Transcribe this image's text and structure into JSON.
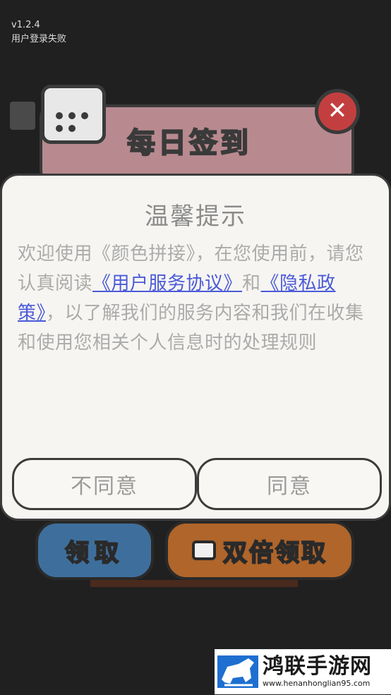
{
  "debug": {
    "version": "v1.2.4",
    "status": "用户登录失败"
  },
  "background": {
    "panel_title": "每日签到",
    "close_glyph": "✕",
    "claim_button": "领取",
    "double_claim_button": "双倍领取"
  },
  "dialog": {
    "title": "温馨提示",
    "body_before": "欢迎使用《颜色拼接》，在您使用前，请您认真阅读",
    "link_terms": "《用户服务协议》",
    "body_and": "和",
    "link_privacy": "《隐私政策》",
    "body_after": "，以了解我们的服务内容和我们在收集和使用您相关个人信息时的处理规则",
    "disagree_label": "不同意",
    "agree_label": "同意"
  },
  "watermark": {
    "title": "鸿联手游网",
    "url": "www.henanhonglian95.com"
  },
  "colors": {
    "link": "#4b5ad8",
    "dialog_bg": "#f6f5f2",
    "overlay": "#202020"
  }
}
